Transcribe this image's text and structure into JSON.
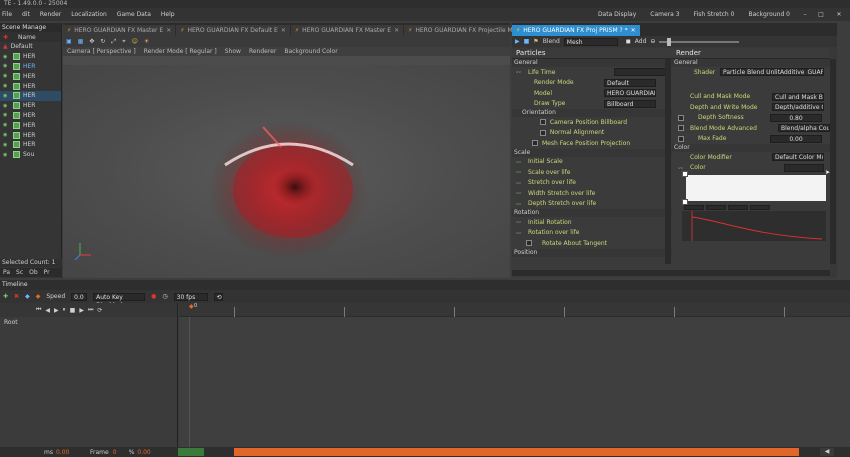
{
  "window": {
    "title": "TE - 1.49.0.0 - 25004"
  },
  "menu": {
    "items": [
      "File",
      "dit",
      "Render",
      "Localization",
      "Game Data",
      "Help"
    ],
    "right": [
      "Data Display",
      "Camera 3",
      "Fish Stretch 0",
      "Background 0"
    ]
  },
  "outliner": {
    "title": "Scene Manage",
    "column": "Name",
    "items": [
      "Default",
      "HER",
      "HER",
      "HER",
      "HER",
      "HER",
      "HER",
      "HER",
      "HER",
      "HER",
      "HER",
      "Sou"
    ],
    "footer": "Selected Count: 1",
    "tabs": [
      "Pa",
      "Sc",
      "Ob",
      "Pr"
    ]
  },
  "viewport": {
    "tabs": [
      "HERO GUARDIAN FX Master E",
      "HERO GUARDIAN FX Default E",
      "HERO GUARDIAN FX Master E",
      "HERO GUARDIAN FX Projectile MASK Only"
    ],
    "options": [
      "Camera [ Perspective ]",
      "Render Mode [ Regular ]",
      "Show",
      "Renderer",
      "Background Color"
    ]
  },
  "inspector": {
    "tab": "HERO GUARDIAN FX Proj PRISM ? *",
    "tool": {
      "label": "Blend",
      "value": "Mesh",
      "add": "Add"
    },
    "particles": {
      "header": "Particles",
      "general": "General",
      "rows": [
        {
          "label": "Life Time",
          "value": ""
        },
        {
          "label": "Render Mode",
          "value": "Default"
        },
        {
          "label": "Model",
          "value": "HERO GUARDIAN_FX_Sphere_GUARD"
        },
        {
          "label": "Draw Type",
          "value": "Billboard"
        }
      ],
      "orientation": "Orientation",
      "orientRows": [
        "Camera Position Billboard",
        "Normal Alignment",
        "Mesh Face Position Projection"
      ],
      "scale": "Scale",
      "scaleRows": [
        "Initial Scale",
        "Scale over life",
        "Stretch over life",
        "Width Stretch over life",
        "Depth Stretch over life"
      ],
      "rotation": "Rotation",
      "rotRows": [
        "Initial Rotation",
        "Rotation over life",
        "Rotate About Tangent"
      ],
      "position": "Position"
    },
    "render": {
      "header": "Render",
      "general": "General",
      "shader_label": "Shader",
      "shader_value": "Particle Blend UnlitAdditive_GUARD",
      "rows": [
        {
          "label": "Cull and Mask Mode",
          "value": "Cull and Mask Blend"
        },
        {
          "label": "Depth and Write Mode",
          "value": "Depth/additive Cul"
        },
        {
          "label": "Depth Softness",
          "value": "0.80"
        },
        {
          "label": "Blend Mode Advanced",
          "value": "Blend/alpha Counter"
        },
        {
          "label": "Max Fade",
          "value": "0.00"
        }
      ],
      "color_section": "Color",
      "color_rows": [
        {
          "label": "Color Modifier",
          "value": "Default Color Mult"
        },
        {
          "label": "Color",
          "value": ""
        }
      ]
    }
  },
  "timeline": {
    "title": "Timeline",
    "speed_label": "Speed",
    "speed_value": "0.0",
    "mode": "Auto Key Disabled",
    "fps": "30 fps",
    "track": "Root",
    "start_frame": "0",
    "status": {
      "ms_label": "ms",
      "ms_value": "0.00",
      "frame_label": "Frame",
      "frame_value": "0",
      "pct_label": "%",
      "pct_value": "0.00"
    }
  },
  "colors": {
    "accent": "#2d8ed0",
    "timeline_bar": "#e0662a",
    "effect": "#d9262a"
  }
}
